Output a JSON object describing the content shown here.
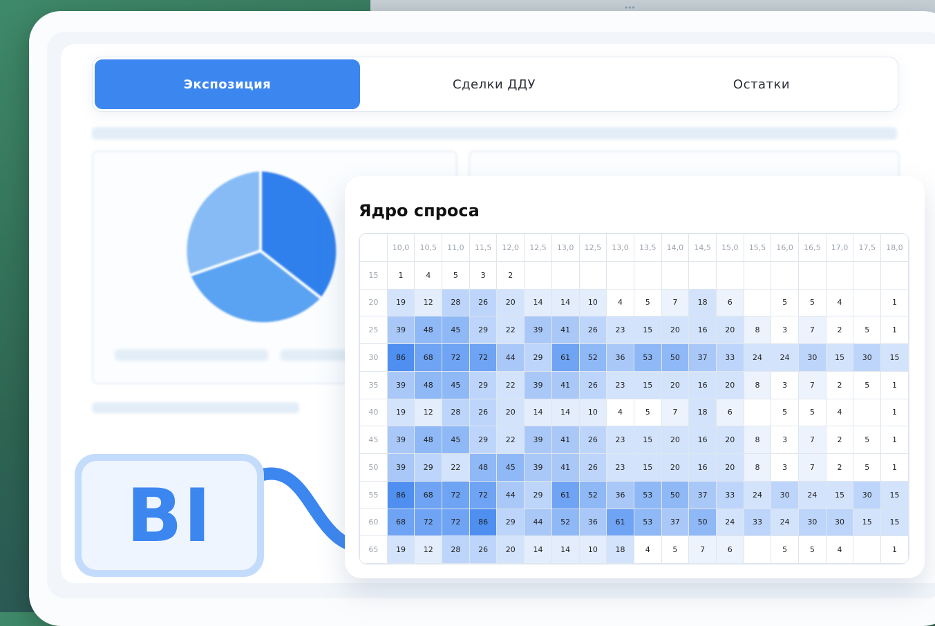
{
  "top_window": {
    "dots": "•••"
  },
  "tabs": [
    {
      "label": "Экспозиция",
      "active": true
    },
    {
      "label": "Сделки ДДУ",
      "active": false
    },
    {
      "label": "Остатки",
      "active": false
    }
  ],
  "badge": {
    "text": "BI"
  },
  "colors": {
    "accent": "#3c86f0",
    "badge_bg": "#c4dcfb"
  },
  "heatmap": {
    "title": "Ядро спроса",
    "columns": [
      "10,0",
      "10,5",
      "11,0",
      "11,5",
      "12,0",
      "12,5",
      "13,0",
      "12,5",
      "13,0",
      "13,5",
      "14,0",
      "14,5",
      "15,0",
      "15,5",
      "16,0",
      "16,5",
      "17,0",
      "17,5",
      "18,0"
    ],
    "rows": [
      {
        "label": "15",
        "values": [
          "1",
          "4",
          "5",
          "3",
          "2",
          "",
          "",
          "",
          "",
          "",
          "",
          "",
          "",
          "",
          "",
          "",
          "",
          "",
          ""
        ]
      },
      {
        "label": "20",
        "values": [
          "19",
          "12",
          "28",
          "26",
          "20",
          "14",
          "14",
          "10",
          "4",
          "5",
          "7",
          "18",
          "6",
          "",
          "5",
          "5",
          "4",
          "",
          "1"
        ]
      },
      {
        "label": "25",
        "values": [
          "39",
          "48",
          "45",
          "29",
          "22",
          "39",
          "41",
          "26",
          "23",
          "15",
          "20",
          "16",
          "20",
          "8",
          "3",
          "7",
          "2",
          "5",
          "1"
        ]
      },
      {
        "label": "30",
        "values": [
          "86",
          "68",
          "72",
          "72",
          "44",
          "29",
          "61",
          "52",
          "36",
          "53",
          "50",
          "37",
          "33",
          "24",
          "24",
          "30",
          "15",
          "30",
          "15"
        ]
      },
      {
        "label": "35",
        "values": [
          "39",
          "48",
          "45",
          "29",
          "22",
          "39",
          "41",
          "26",
          "23",
          "15",
          "20",
          "16",
          "20",
          "8",
          "3",
          "7",
          "2",
          "5",
          "1"
        ]
      },
      {
        "label": "40",
        "values": [
          "19",
          "12",
          "28",
          "26",
          "20",
          "14",
          "14",
          "10",
          "4",
          "5",
          "7",
          "18",
          "6",
          "",
          "5",
          "5",
          "4",
          "",
          "1"
        ]
      },
      {
        "label": "45",
        "values": [
          "39",
          "48",
          "45",
          "29",
          "22",
          "39",
          "41",
          "26",
          "23",
          "15",
          "20",
          "16",
          "20",
          "8",
          "3",
          "7",
          "2",
          "5",
          "1"
        ]
      },
      {
        "label": "50",
        "values": [
          "39",
          "29",
          "22",
          "48",
          "45",
          "39",
          "41",
          "26",
          "23",
          "15",
          "20",
          "16",
          "20",
          "8",
          "3",
          "7",
          "2",
          "5",
          "1"
        ]
      },
      {
        "label": "55",
        "values": [
          "86",
          "68",
          "72",
          "72",
          "44",
          "29",
          "61",
          "52",
          "36",
          "53",
          "50",
          "37",
          "33",
          "24",
          "30",
          "24",
          "15",
          "30",
          "15"
        ]
      },
      {
        "label": "60",
        "values": [
          "68",
          "72",
          "72",
          "86",
          "29",
          "44",
          "52",
          "36",
          "61",
          "53",
          "37",
          "50",
          "24",
          "33",
          "24",
          "30",
          "30",
          "15",
          "15"
        ]
      },
      {
        "label": "65",
        "values": [
          "19",
          "12",
          "28",
          "26",
          "20",
          "14",
          "14",
          "10",
          "18",
          "4",
          "5",
          "7",
          "6",
          "",
          "5",
          "5",
          "4",
          "",
          "1"
        ]
      }
    ]
  }
}
